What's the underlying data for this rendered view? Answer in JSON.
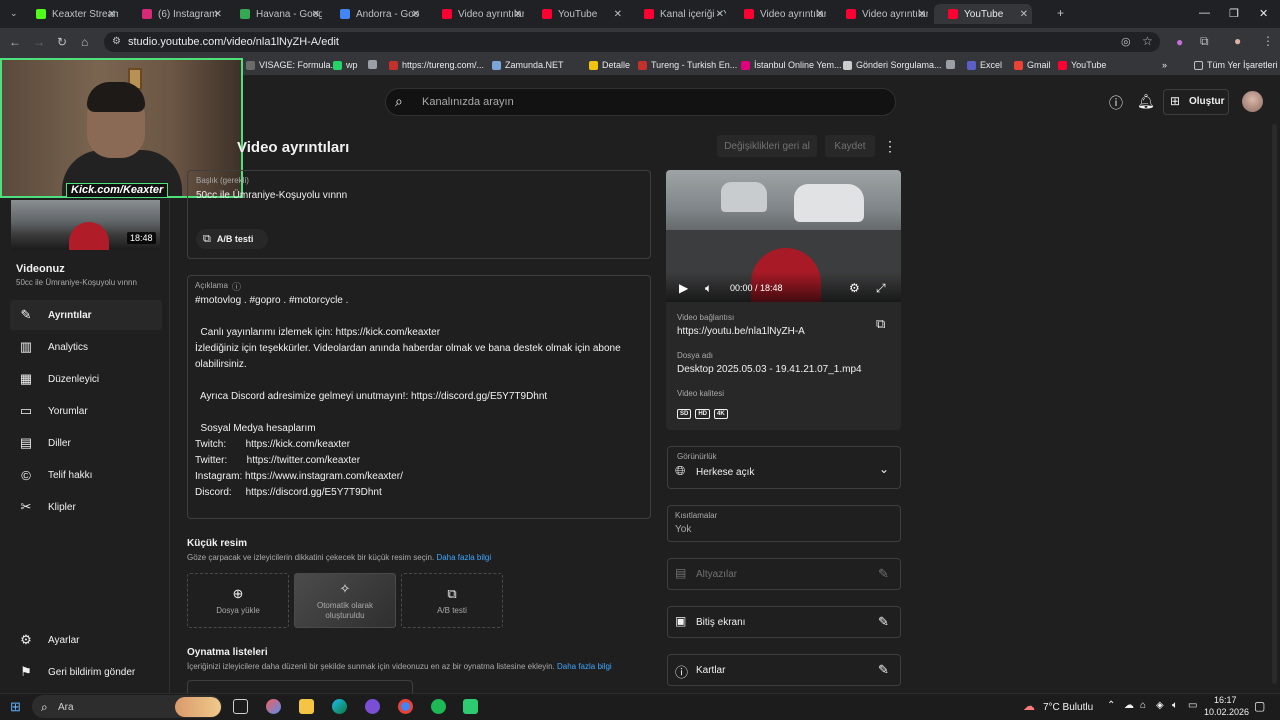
{
  "browser": {
    "tabs": [
      {
        "title": "Keaxter Stream",
        "color": "#53fc18"
      },
      {
        "title": "(6) Instagram",
        "color": "#d62976"
      },
      {
        "title": "Havana - Goog",
        "color": "#34a853"
      },
      {
        "title": "Andorra - Goo",
        "color": "#4285f4"
      },
      {
        "title": "Video ayrıntılar",
        "color": "#ff0033"
      },
      {
        "title": "YouTube",
        "color": "#ff0033"
      },
      {
        "title": "Kanal içeriği - Y",
        "color": "#ff0033"
      },
      {
        "title": "Video ayrıntılar",
        "color": "#ff0033"
      },
      {
        "title": "Video ayrıntılar",
        "color": "#ff0033"
      },
      {
        "title": "YouTube",
        "color": "#ff0033"
      }
    ],
    "url": "studio.youtube.com/video/nla1lNyZH-A/edit",
    "bookmarks": [
      {
        "label": "VISAGE: Formula...",
        "color": "#6b6b6b"
      },
      {
        "label": "wp",
        "color": "#25d366"
      },
      {
        "label": "",
        "color": "#9aa0a6"
      },
      {
        "label": "https://tureng.com/...",
        "color": "#c4302b"
      },
      {
        "label": "Zamunda.NET",
        "color": "#7aa7d8"
      },
      {
        "label": "Detalle",
        "color": "#f2c40f"
      },
      {
        "label": "Tureng - Turkish En...",
        "color": "#c4302b"
      },
      {
        "label": "İstanbul Online Yem...",
        "color": "#e3007e"
      },
      {
        "label": "Gönderi Sorgulama...",
        "color": "#cccccc"
      },
      {
        "label": "",
        "color": "#9aa0a6"
      },
      {
        "label": "Excel",
        "color": "#5b5fc7"
      },
      {
        "label": "Gmail",
        "color": "#ea4335"
      },
      {
        "label": "YouTube",
        "color": "#ff0033"
      }
    ],
    "bookmarks_more": "»",
    "all_bookmarks": "Tüm Yer İşaretleri"
  },
  "header": {
    "search_placeholder": "Kanalınızda arayın",
    "create_label": "Oluştur"
  },
  "webcam": {
    "tag": "Kick.com/Keaxter"
  },
  "sidebar": {
    "duration": "18:48",
    "your_video": "Videonuz",
    "video_title": "50cc ile Ümraniye-Koşuyolu vınnn",
    "items": [
      {
        "label": "Ayrıntılar",
        "icon": "pencil-icon"
      },
      {
        "label": "Analytics",
        "icon": "analytics-icon"
      },
      {
        "label": "Düzenleyici",
        "icon": "editor-icon"
      },
      {
        "label": "Yorumlar",
        "icon": "comments-icon"
      },
      {
        "label": "Diller",
        "icon": "subtitles-icon"
      },
      {
        "label": "Telif hakkı",
        "icon": "copyright-icon"
      },
      {
        "label": "Klipler",
        "icon": "scissors-icon"
      }
    ],
    "settings": "Ayarlar",
    "feedback": "Geri bildirim gönder"
  },
  "main": {
    "title": "Video ayrıntıları",
    "undo": "Değişiklikleri geri al",
    "save": "Kaydet",
    "title_field_label": "Başlık (gerekli)",
    "title_value": "50cc ile Ümraniye-Koşuyolu vınnn",
    "ab_test": "A/B testi",
    "description_label": "Açıklama",
    "description_lines": [
      "#motovlog . #gopro . #motorcycle .",
      "",
      "  Canlı yayınlarımı izlemek için: https://kick.com/keaxter",
      "İzlediğiniz için teşekkürler. Videolardan anında haberdar olmak ve bana destek olmak için abone",
      "olabilirsiniz.",
      "",
      "  Ayrıca Discord adresimize gelmeyi unutmayın!: https://discord.gg/E5Y7T9Dhnt",
      "",
      "  Sosyal Medya hesaplarım",
      "Twitch:       https://kick.com/keaxter",
      "Twitter:       https://twitter.com/keaxter",
      "Instagram: https://www.instagram.com/keaxter/",
      "Discord:     https://discord.gg/E5Y7T9Dhnt"
    ],
    "thumbnail_title": "Küçük resim",
    "thumbnail_sub": "Göze çarpacak ve izleyicilerin dikkatini çekecek bir küçük resim seçin.",
    "learn_more": "Daha fazla bilgi",
    "thumb_upload": "Dosya yükle",
    "thumb_auto_1": "Otomatik olarak",
    "thumb_auto_2": "oluşturuldu",
    "thumb_ab": "A/B testi",
    "playlists_title": "Oynatma listeleri",
    "playlists_sub": "İçeriğinizi izleyicilere daha düzenli bir şekilde sunmak için videonuzu en az bir oynatma listesine ekleyin.",
    "playlists_learn_more": "Daha fazla bilgi"
  },
  "right": {
    "time": "00:00 / 18:48",
    "video_link_label": "Video bağlantısı",
    "video_link": "https://youtu.be/nla1lNyZH-A",
    "filename_label": "Dosya adı",
    "filename": "Desktop 2025.05.03 - 19.41.21.07_1.mp4",
    "quality_label": "Video kalitesi",
    "quality": [
      "SD",
      "HD",
      "4K"
    ],
    "visibility_label": "Görünürlük",
    "visibility": "Herkese açık",
    "restrictions_label": "Kısıtlamalar",
    "restrictions": "Yok",
    "subtitles": "Altyazılar",
    "end_screen": "Bitiş ekranı",
    "cards": "Kartlar"
  },
  "taskbar": {
    "search": "Ara",
    "weather": "7°C  Bulutlu",
    "time": "16:17",
    "date": "10.02.2026"
  }
}
